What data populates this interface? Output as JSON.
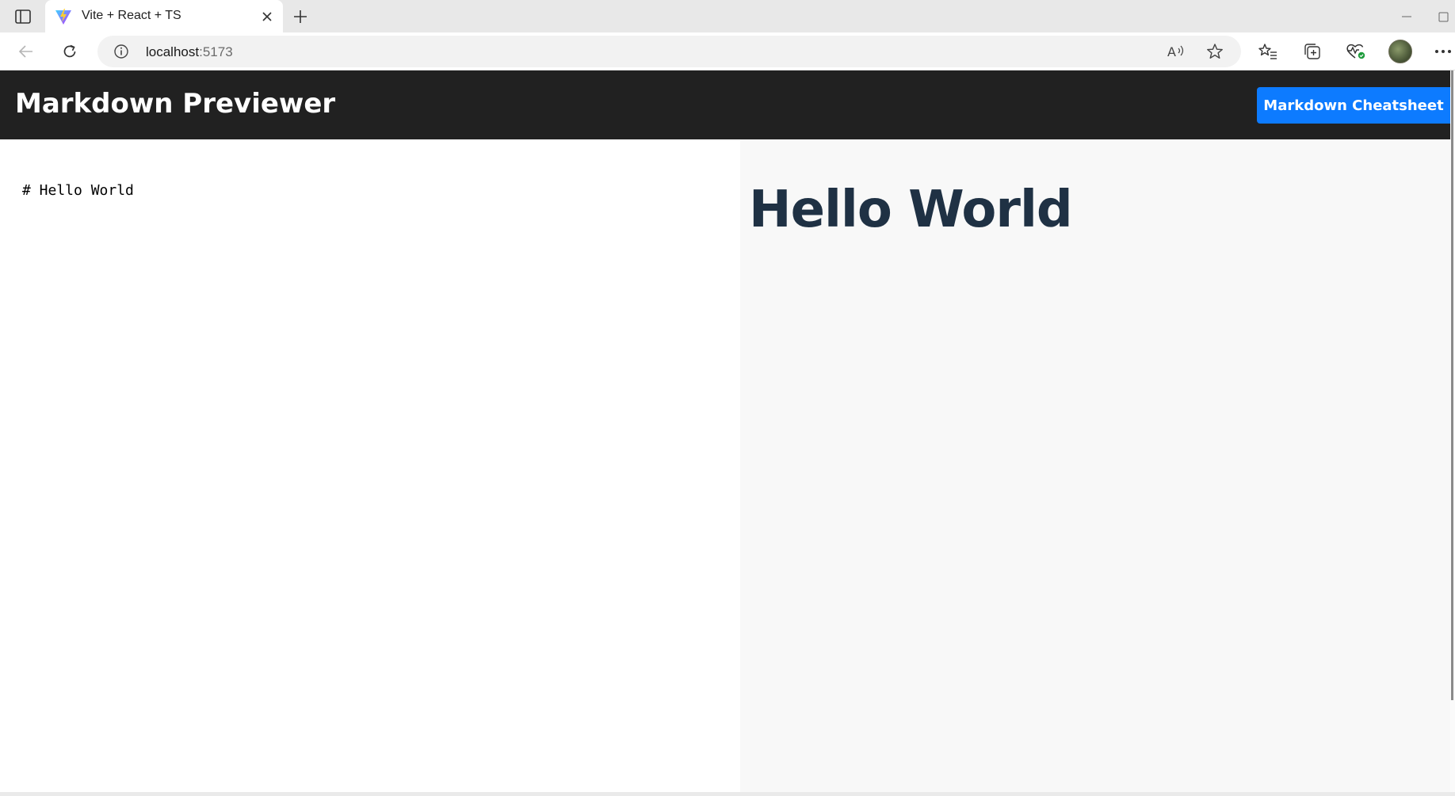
{
  "browser": {
    "tab": {
      "title": "Vite + React + TS",
      "favicon": "vite-logo-icon"
    },
    "address": {
      "host": "localhost",
      "port": ":5173"
    },
    "icons": {
      "sidebar": "sidebar-toggle-icon",
      "close": "close-icon",
      "new_tab": "plus-icon",
      "back": "back-arrow-icon",
      "reload": "reload-icon",
      "info": "info-icon",
      "read_aloud": "read-aloud-icon",
      "favorite": "star-icon",
      "favorites": "favorites-list-icon",
      "collections": "collections-icon",
      "health": "heart-pulse-icon",
      "profile": "avatar",
      "more": "more-dots-icon"
    }
  },
  "app": {
    "title": "Markdown Previewer",
    "cheatsheet_button": "Markdown Cheatsheet",
    "editor": {
      "content": "# Hello World"
    },
    "preview": {
      "heading": "Hello World"
    },
    "colors": {
      "header_bg": "#212121",
      "button_bg": "#0d7bff",
      "preview_bg": "#f8f8f8",
      "heading_color": "#1f3144"
    }
  }
}
